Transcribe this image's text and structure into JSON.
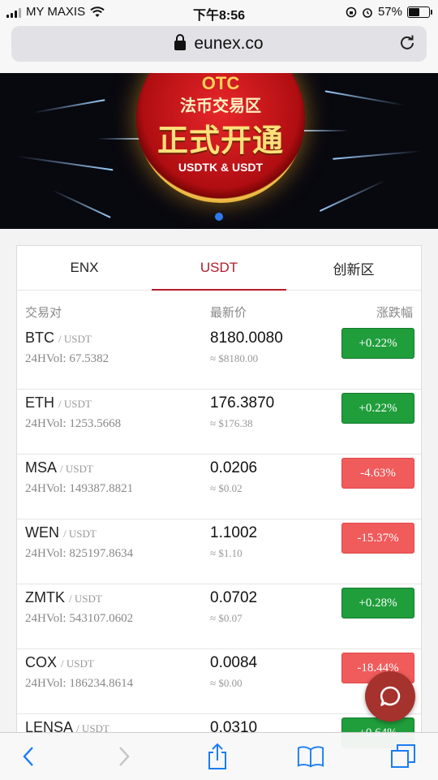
{
  "status_bar": {
    "carrier": "MY MAXIS",
    "time": "下午8:56",
    "battery": "57%",
    "battery_level": 0.57
  },
  "browser": {
    "url": "eunex.co"
  },
  "banner": {
    "logo_text": "OTC 法币交易区 正式开通 USDTK & USDT"
  },
  "market": {
    "tabs": [
      {
        "label": "ENX",
        "active": false
      },
      {
        "label": "USDT",
        "active": true
      },
      {
        "label": "创新区",
        "active": false
      }
    ],
    "headers": {
      "pair": "交易对",
      "price": "最新价",
      "change": "涨跌幅"
    },
    "rows": [
      {
        "base": "BTC",
        "quote": "/ USDT",
        "volume": "24HVol: 67.5382",
        "price": "8180.0080",
        "approx": "≈ $8180.00",
        "change": "+0.22%",
        "direction": "up"
      },
      {
        "base": "ETH",
        "quote": "/ USDT",
        "volume": "24HVol: 1253.5668",
        "price": "176.3870",
        "approx": "≈ $176.38",
        "change": "+0.22%",
        "direction": "up"
      },
      {
        "base": "MSA",
        "quote": "/ USDT",
        "volume": "24HVol: 149387.8821",
        "price": "0.0206",
        "approx": "≈ $0.02",
        "change": "-4.63%",
        "direction": "down"
      },
      {
        "base": "WEN",
        "quote": "/ USDT",
        "volume": "24HVol: 825197.8634",
        "price": "1.1002",
        "approx": "≈ $1.10",
        "change": "-15.37%",
        "direction": "down"
      },
      {
        "base": "ZMTK",
        "quote": "/ USDT",
        "volume": "24HVol: 543107.0602",
        "price": "0.0702",
        "approx": "≈ $0.07",
        "change": "+0.28%",
        "direction": "up"
      },
      {
        "base": "COX",
        "quote": "/ USDT",
        "volume": "24HVol: 186234.8614",
        "price": "0.0084",
        "approx": "≈ $0.00",
        "change": "-18.44%",
        "direction": "down"
      },
      {
        "base": "LENSA",
        "quote": "/ USDT",
        "volume": "",
        "price": "0.0310",
        "approx": "",
        "change": "+0.64%",
        "direction": "up"
      }
    ]
  },
  "colors": {
    "accent": "#b21d2a",
    "up": "#1f9e3b",
    "down": "#f05b5b",
    "chat": "#a5322c",
    "ios_blue": "#1a7cf5"
  },
  "icons": {
    "chat": "chat-bubble-icon",
    "back": "back-chevron-icon",
    "forward": "forward-chevron-icon",
    "share": "share-icon",
    "bookmarks": "book-icon",
    "tabs": "tabs-icon"
  }
}
